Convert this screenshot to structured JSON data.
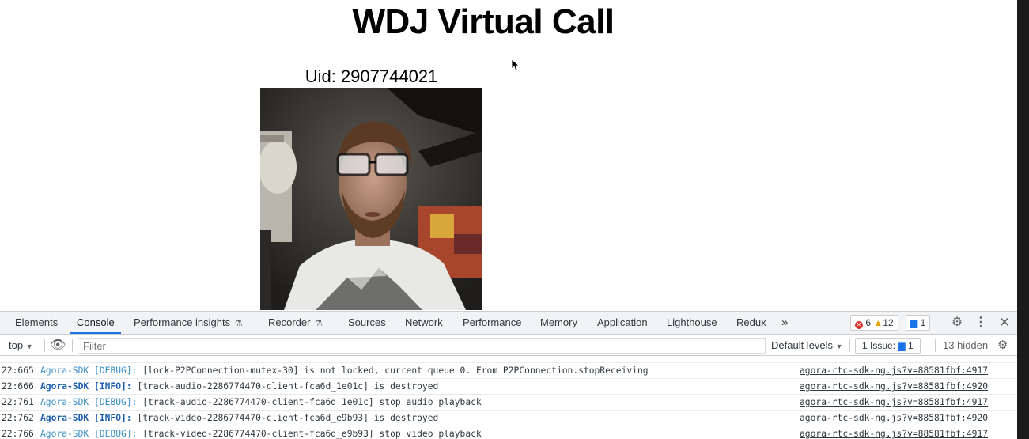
{
  "page": {
    "title": "WDJ Virtual Call",
    "uid_label": "Uid: 2907744021"
  },
  "devtools": {
    "tabs": [
      {
        "label": "Elements"
      },
      {
        "label": "Console",
        "active": true
      },
      {
        "label": "Performance insights"
      },
      {
        "label": "Recorder"
      },
      {
        "label": "Sources"
      },
      {
        "label": "Network"
      },
      {
        "label": "Performance"
      },
      {
        "label": "Memory"
      },
      {
        "label": "Application"
      },
      {
        "label": "Lighthouse"
      },
      {
        "label": "Redux"
      }
    ],
    "more_tabs": "»",
    "counts": {
      "errors": "6",
      "warnings": "12",
      "messages": "1"
    },
    "filter_bar": {
      "context": "top",
      "filter_placeholder": "Filter",
      "levels": "Default levels",
      "issues_label": "1 Issue:",
      "issues_count": "1",
      "hidden": "13 hidden"
    },
    "console_rows": [
      {
        "time": "22:665",
        "tag": "Agora-SDK [DEBUG]:",
        "level": "debug",
        "message": "[lock-P2PConnection-mutex-30] is not locked, current queue 0. From P2PConnection.stopReceiving",
        "source": "agora-rtc-sdk-ng.js?v=88581fbf:4917"
      },
      {
        "time": "22:666",
        "tag": "Agora-SDK [INFO]:",
        "level": "info",
        "message": "[track-audio-2286774470-client-fca6d_1e01c] is destroyed",
        "source": "agora-rtc-sdk-ng.js?v=88581fbf:4920"
      },
      {
        "time": "22:761",
        "tag": "Agora-SDK [DEBUG]:",
        "level": "debug",
        "message": "[track-audio-2286774470-client-fca6d_1e01c] stop audio playback",
        "source": "agora-rtc-sdk-ng.js?v=88581fbf:4917"
      },
      {
        "time": "22:762",
        "tag": "Agora-SDK [INFO]:",
        "level": "info",
        "message": "[track-video-2286774470-client-fca6d_e9b93] is destroyed",
        "source": "agora-rtc-sdk-ng.js?v=88581fbf:4920"
      },
      {
        "time": "22:766",
        "tag": "Agora-SDK [DEBUG]:",
        "level": "debug",
        "message": "[track-video-2286774470-client-fca6d_e9b93] stop video playback",
        "source": "agora-rtc-sdk-ng.js?v=88581fbf:4917"
      }
    ]
  },
  "icons": {
    "flask": "flask-icon",
    "eye": "eye-icon",
    "gear": "gear-icon",
    "kebab": "kebab-menu-icon",
    "close": "close-icon"
  },
  "colors": {
    "accent": "#1a73e8",
    "error": "#d93025",
    "warning": "#e8a000",
    "debug_tag": "#3a8fc9",
    "info_tag": "#1f5fae"
  }
}
